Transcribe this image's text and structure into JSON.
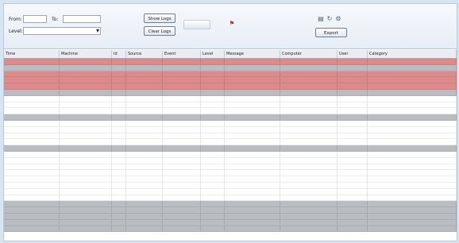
{
  "toolbar": {
    "from_label": "From:",
    "from_value": "",
    "to_label": "To:",
    "to_value": "",
    "level_label": "Level:",
    "level_value": "",
    "show_button": "Show Logs",
    "clear_button": "Clear Logs",
    "disabled_button": "",
    "export_button": "Export"
  },
  "columns": [
    "Time",
    "Machine",
    "Id",
    "Source",
    "Event",
    "Level",
    "Message",
    "Computer",
    "User",
    "Category"
  ],
  "rows": [
    {
      "style": "red",
      "cells": [
        "",
        "",
        "",
        "",
        "",
        "",
        "",
        "",
        "",
        ""
      ]
    },
    {
      "style": "gray",
      "cells": [
        "",
        "",
        "",
        "",
        "",
        "",
        "",
        "",
        "",
        ""
      ]
    },
    {
      "style": "red",
      "cells": [
        "",
        "",
        "",
        "",
        "",
        "",
        "",
        "",
        "",
        ""
      ]
    },
    {
      "style": "red",
      "cells": [
        "",
        "",
        "",
        "",
        "",
        "",
        "",
        "",
        "",
        ""
      ]
    },
    {
      "style": "red",
      "cells": [
        "",
        "",
        "",
        "",
        "",
        "",
        "",
        "",
        "",
        ""
      ]
    },
    {
      "style": "gray",
      "cells": [
        "",
        "",
        "",
        "",
        "",
        "",
        "",
        "",
        "",
        ""
      ]
    },
    {
      "style": "white",
      "cells": [
        "",
        "",
        "",
        "",
        "",
        "",
        "",
        "",
        "",
        ""
      ]
    },
    {
      "style": "white",
      "cells": [
        "",
        "",
        "",
        "",
        "",
        "",
        "",
        "",
        "",
        ""
      ]
    },
    {
      "style": "white",
      "cells": [
        "",
        "",
        "",
        "",
        "",
        "",
        "",
        "",
        "",
        ""
      ]
    },
    {
      "style": "gray",
      "cells": [
        "",
        "",
        "",
        "",
        "",
        "",
        "",
        "",
        "",
        ""
      ]
    },
    {
      "style": "white",
      "cells": [
        "",
        "",
        "",
        "",
        "",
        "",
        "",
        "",
        "",
        ""
      ]
    },
    {
      "style": "white",
      "cells": [
        "",
        "",
        "",
        "",
        "",
        "",
        "",
        "",
        "",
        ""
      ]
    },
    {
      "style": "white",
      "cells": [
        "",
        "",
        "",
        "",
        "",
        "",
        "",
        "",
        "",
        ""
      ]
    },
    {
      "style": "white",
      "cells": [
        "",
        "",
        "",
        "",
        "",
        "",
        "",
        "",
        "",
        ""
      ]
    },
    {
      "style": "gray",
      "cells": [
        "",
        "",
        "",
        "",
        "",
        "",
        "",
        "",
        "",
        ""
      ]
    },
    {
      "style": "white",
      "cells": [
        "",
        "",
        "",
        "",
        "",
        "",
        "",
        "",
        "",
        ""
      ]
    },
    {
      "style": "white",
      "cells": [
        "",
        "",
        "",
        "",
        "",
        "",
        "",
        "",
        "",
        ""
      ]
    },
    {
      "style": "white",
      "cells": [
        "",
        "",
        "",
        "",
        "",
        "",
        "",
        "",
        "",
        ""
      ]
    },
    {
      "style": "white",
      "cells": [
        "",
        "",
        "",
        "",
        "",
        "",
        "",
        "",
        "",
        ""
      ]
    },
    {
      "style": "white",
      "cells": [
        "",
        "",
        "",
        "",
        "",
        "",
        "",
        "",
        "",
        ""
      ]
    },
    {
      "style": "white",
      "cells": [
        "",
        "",
        "",
        "",
        "",
        "",
        "",
        "",
        "",
        ""
      ]
    },
    {
      "style": "white",
      "cells": [
        "",
        "",
        "",
        "",
        "",
        "",
        "",
        "",
        "",
        ""
      ]
    },
    {
      "style": "white",
      "cells": [
        "",
        "",
        "",
        "",
        "",
        "",
        "",
        "",
        "",
        ""
      ]
    },
    {
      "style": "gray",
      "cells": [
        "",
        "",
        "",
        "",
        "",
        "",
        "",
        "",
        "",
        ""
      ]
    },
    {
      "style": "gray",
      "cells": [
        "",
        "",
        "",
        "",
        "",
        "",
        "",
        "",
        "",
        ""
      ]
    },
    {
      "style": "gray",
      "cells": [
        "",
        "",
        "",
        "",
        "",
        "",
        "",
        "",
        "",
        ""
      ]
    },
    {
      "style": "gray",
      "cells": [
        "",
        "",
        "",
        "",
        "",
        "",
        "",
        "",
        "",
        ""
      ]
    },
    {
      "style": "gray",
      "cells": [
        "",
        "",
        "",
        "",
        "",
        "",
        "",
        "",
        "",
        ""
      ]
    }
  ],
  "icons": {
    "refresh": "refresh-icon",
    "filter": "filter-icon",
    "print": "print-icon",
    "settings": "gear-icon"
  },
  "colors": {
    "error_row": "#dd8a8a",
    "separator_row": "#b9bcc0",
    "background": "#d7e4f1"
  }
}
